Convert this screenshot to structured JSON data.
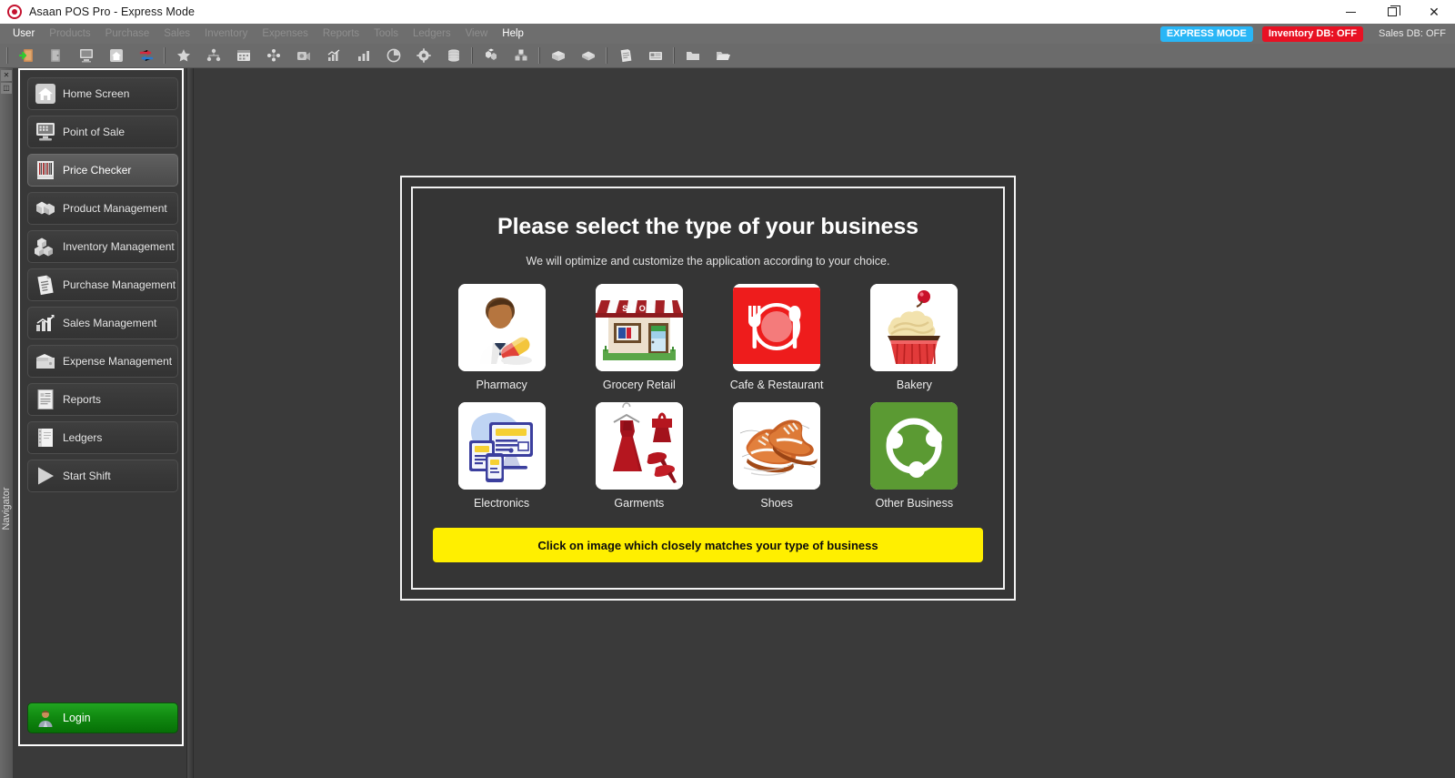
{
  "window": {
    "title": "Asaan POS Pro - Express Mode",
    "app_icon": "record-circle-icon",
    "controls": {
      "minimize": "minimize-icon",
      "maximize": "maximize-icon",
      "close": "close-icon"
    }
  },
  "menubar": {
    "items": [
      {
        "label": "User",
        "active": true
      },
      {
        "label": "Products",
        "active": false
      },
      {
        "label": "Purchase",
        "active": false
      },
      {
        "label": "Sales",
        "active": false
      },
      {
        "label": "Inventory",
        "active": false
      },
      {
        "label": "Expenses",
        "active": false
      },
      {
        "label": "Reports",
        "active": false
      },
      {
        "label": "Tools",
        "active": false
      },
      {
        "label": "Ledgers",
        "active": false
      },
      {
        "label": "View",
        "active": false
      },
      {
        "label": "Help",
        "active": true
      }
    ],
    "badges": [
      {
        "label": "EXPRESS MODE",
        "color": "#29b6f6",
        "text_color": "#ffffff"
      },
      {
        "label": "Inventory DB: OFF",
        "color": "#e81123",
        "text_color": "#ffffff"
      },
      {
        "label": "Sales DB: OFF",
        "color": "transparent",
        "text_color": "#e9e9e9"
      }
    ]
  },
  "toolbar": {
    "buttons": [
      {
        "name": "login-door-icon"
      },
      {
        "name": "logout-door-icon"
      },
      {
        "name": "point-of-sale-icon"
      },
      {
        "name": "home-icon"
      },
      {
        "name": "transfer-arrows-icon"
      },
      {
        "name": "separator"
      },
      {
        "name": "favorite-star-icon"
      },
      {
        "name": "org-chart-icon"
      },
      {
        "name": "calendar-icon"
      },
      {
        "name": "users-group-icon"
      },
      {
        "name": "camera-icon"
      },
      {
        "name": "sales-chart-icon"
      },
      {
        "name": "bar-chart-icon"
      },
      {
        "name": "pie-chart-icon"
      },
      {
        "name": "settings-gear-icon"
      },
      {
        "name": "database-icon"
      },
      {
        "name": "separator"
      },
      {
        "name": "products-boxes-icon"
      },
      {
        "name": "inventory-stack-icon"
      },
      {
        "name": "separator"
      },
      {
        "name": "open-box-icon"
      },
      {
        "name": "package-icon"
      },
      {
        "name": "separator"
      },
      {
        "name": "invoice-icon"
      },
      {
        "name": "card-icon"
      },
      {
        "name": "separator"
      },
      {
        "name": "folder-icon"
      },
      {
        "name": "folder-open-icon"
      }
    ]
  },
  "sidebar": {
    "strip_label": "Navigator",
    "strip_buttons": [
      {
        "name": "close-panel-icon",
        "glyph": "×"
      },
      {
        "name": "pin-panel-icon",
        "glyph": "❐"
      }
    ],
    "items": [
      {
        "label": "Home Screen",
        "icon": "home-icon",
        "selected": false
      },
      {
        "label": "Point of Sale",
        "icon": "pos-terminal-icon",
        "selected": false
      },
      {
        "label": "Price Checker",
        "icon": "barcode-icon",
        "selected": true
      },
      {
        "label": "Product Management",
        "icon": "boxes-icon",
        "selected": false
      },
      {
        "label": "Inventory Management",
        "icon": "inventory-cubes-icon",
        "selected": false
      },
      {
        "label": "Purchase Management",
        "icon": "purchase-doc-icon",
        "selected": false
      },
      {
        "label": "Sales Management",
        "icon": "sales-chart-icon",
        "selected": false
      },
      {
        "label": "Expense Management",
        "icon": "wallet-icon",
        "selected": false
      },
      {
        "label": "Reports",
        "icon": "report-doc-icon",
        "selected": false
      },
      {
        "label": "Ledgers",
        "icon": "notebook-icon",
        "selected": false
      },
      {
        "label": "Start Shift",
        "icon": "play-triangle-icon",
        "selected": false
      }
    ],
    "login_button": {
      "label": "Login",
      "icon": "user-avatar-icon",
      "color": "#118a11"
    }
  },
  "dialog": {
    "title": "Please select the type of your business",
    "subtitle": "We will optimize and customize the application according to your choice.",
    "hint": "Click on image which closely matches your type of business",
    "hint_bg": "#ffef00",
    "tiles": [
      {
        "label": "Pharmacy",
        "icon": "pharmacist-icon"
      },
      {
        "label": "Grocery Retail",
        "icon": "shop-front-icon"
      },
      {
        "label": "Cafe & Restaurant",
        "icon": "cutlery-plate-icon"
      },
      {
        "label": "Bakery",
        "icon": "cupcake-icon"
      },
      {
        "label": "Electronics",
        "icon": "computer-devices-icon"
      },
      {
        "label": "Garments",
        "icon": "dress-heels-icon"
      },
      {
        "label": "Shoes",
        "icon": "shoes-icon"
      },
      {
        "label": "Other Business",
        "icon": "network-circle-icon"
      }
    ]
  }
}
